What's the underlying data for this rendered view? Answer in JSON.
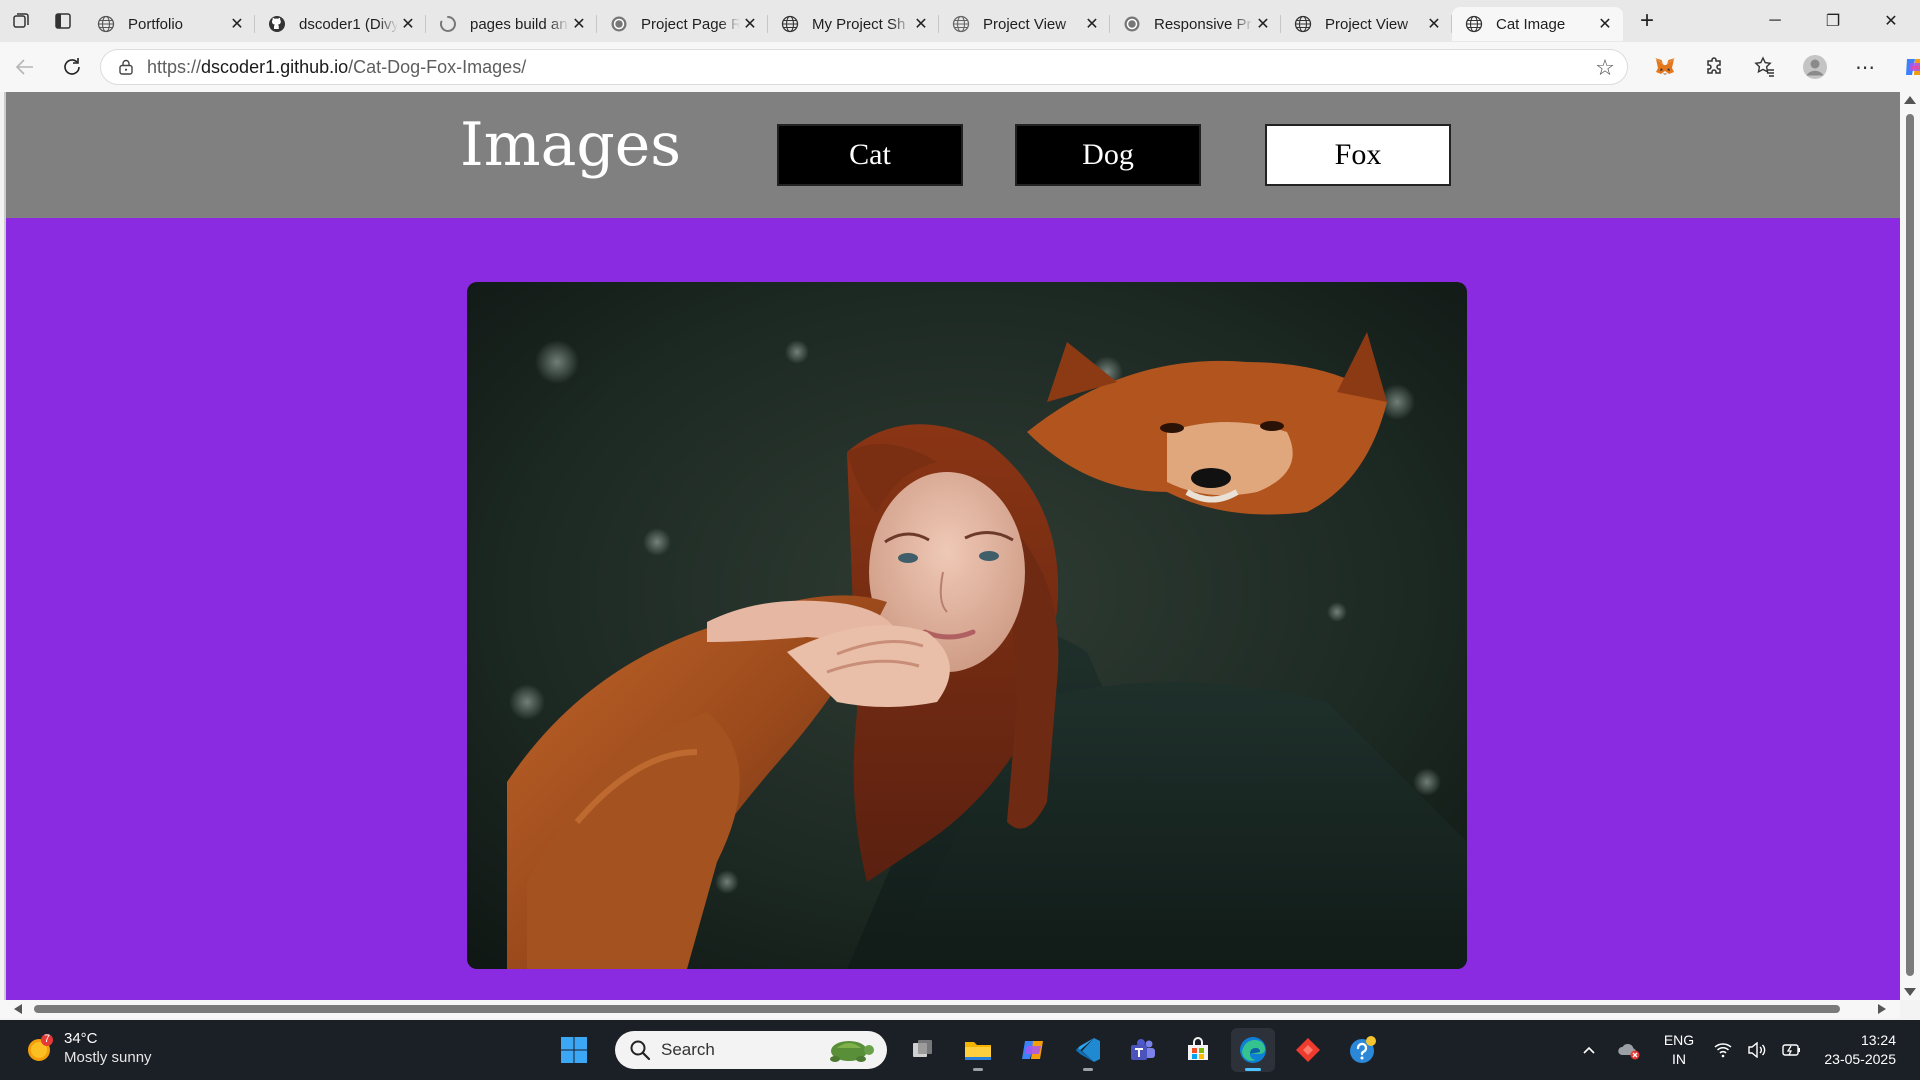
{
  "tabs": [
    {
      "title": "Portfolio",
      "icon": "globe-icon"
    },
    {
      "title": "dscoder1 (Divy",
      "icon": "github-icon"
    },
    {
      "title": "pages build an",
      "icon": "spinner-icon"
    },
    {
      "title": "Project Page R",
      "icon": "ring-icon"
    },
    {
      "title": "My Project Sh",
      "icon": "globe-icon"
    },
    {
      "title": "Project View",
      "icon": "globe-icon"
    },
    {
      "title": "Responsive Pr",
      "icon": "ring-icon"
    },
    {
      "title": "Project View",
      "icon": "globe-icon"
    },
    {
      "title": "Cat Image",
      "icon": "globe-icon"
    }
  ],
  "address": {
    "scheme": "https://",
    "host": "dscoder1.github.io",
    "path": "/Cat-Dog-Fox-Images/"
  },
  "page": {
    "title": "Images",
    "buttons": [
      {
        "label": "Cat",
        "style": "dark"
      },
      {
        "label": "Dog",
        "style": "dark"
      },
      {
        "label": "Fox",
        "style": "light"
      }
    ],
    "image_alt": "Red-haired woman embracing a red fox",
    "colors": {
      "header": "#808080",
      "body": "#8a2be2"
    }
  },
  "taskbar": {
    "weather": {
      "badge": "7",
      "temp": "34°C",
      "condition": "Mostly sunny"
    },
    "search_label": "Search",
    "lang": {
      "top": "ENG",
      "bottom": "IN"
    },
    "clock": {
      "time": "13:24",
      "date": "23-05-2025"
    }
  }
}
